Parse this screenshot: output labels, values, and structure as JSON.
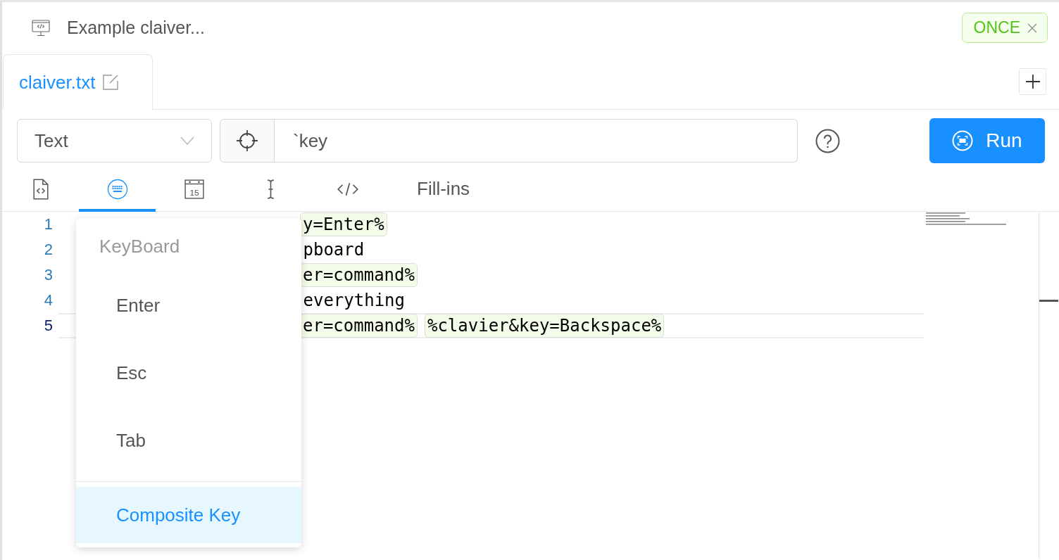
{
  "header": {
    "title": "Example claiver...",
    "badge": {
      "label": "ONCE"
    }
  },
  "tabs": [
    {
      "label": "claiver.txt",
      "selected": true
    }
  ],
  "toolbar": {
    "mode_select": {
      "value": "Text"
    },
    "query_field": {
      "value": "`key"
    },
    "run_button": {
      "label": "Run"
    }
  },
  "insert_tabs": [
    {
      "kind": "snippet",
      "selected": false
    },
    {
      "kind": "keyboard",
      "selected": true
    },
    {
      "kind": "date",
      "day": "15",
      "selected": false
    },
    {
      "kind": "cursor",
      "selected": false
    },
    {
      "kind": "markup",
      "selected": false
    },
    {
      "kind": "text",
      "label": "Fill-ins",
      "selected": false
    }
  ],
  "editor": {
    "lines": [
      {
        "number": "1",
        "current": false,
        "segments": [
          {
            "kind": "token",
            "text": "y=Enter%"
          }
        ]
      },
      {
        "number": "2",
        "current": false,
        "segments": [
          {
            "kind": "plain",
            "text": "pboard"
          }
        ]
      },
      {
        "number": "3",
        "current": false,
        "segments": [
          {
            "kind": "token",
            "text": "er=command%"
          }
        ]
      },
      {
        "number": "4",
        "current": false,
        "segments": [
          {
            "kind": "plain",
            "text": "everything"
          }
        ]
      },
      {
        "number": "5",
        "current": true,
        "segments": [
          {
            "kind": "token",
            "text": "er=command%"
          },
          {
            "kind": "token",
            "text": "%clavier&key=Backspace%"
          }
        ]
      }
    ]
  },
  "key_menu": {
    "sections": [
      {
        "title": "KeyBoard",
        "items": [
          {
            "label": "Enter",
            "selected": false
          },
          {
            "label": "Esc",
            "selected": false
          },
          {
            "label": "Tab",
            "selected": false
          }
        ]
      },
      {
        "items": [
          {
            "label": "Composite Key",
            "selected": true
          }
        ]
      }
    ]
  }
}
